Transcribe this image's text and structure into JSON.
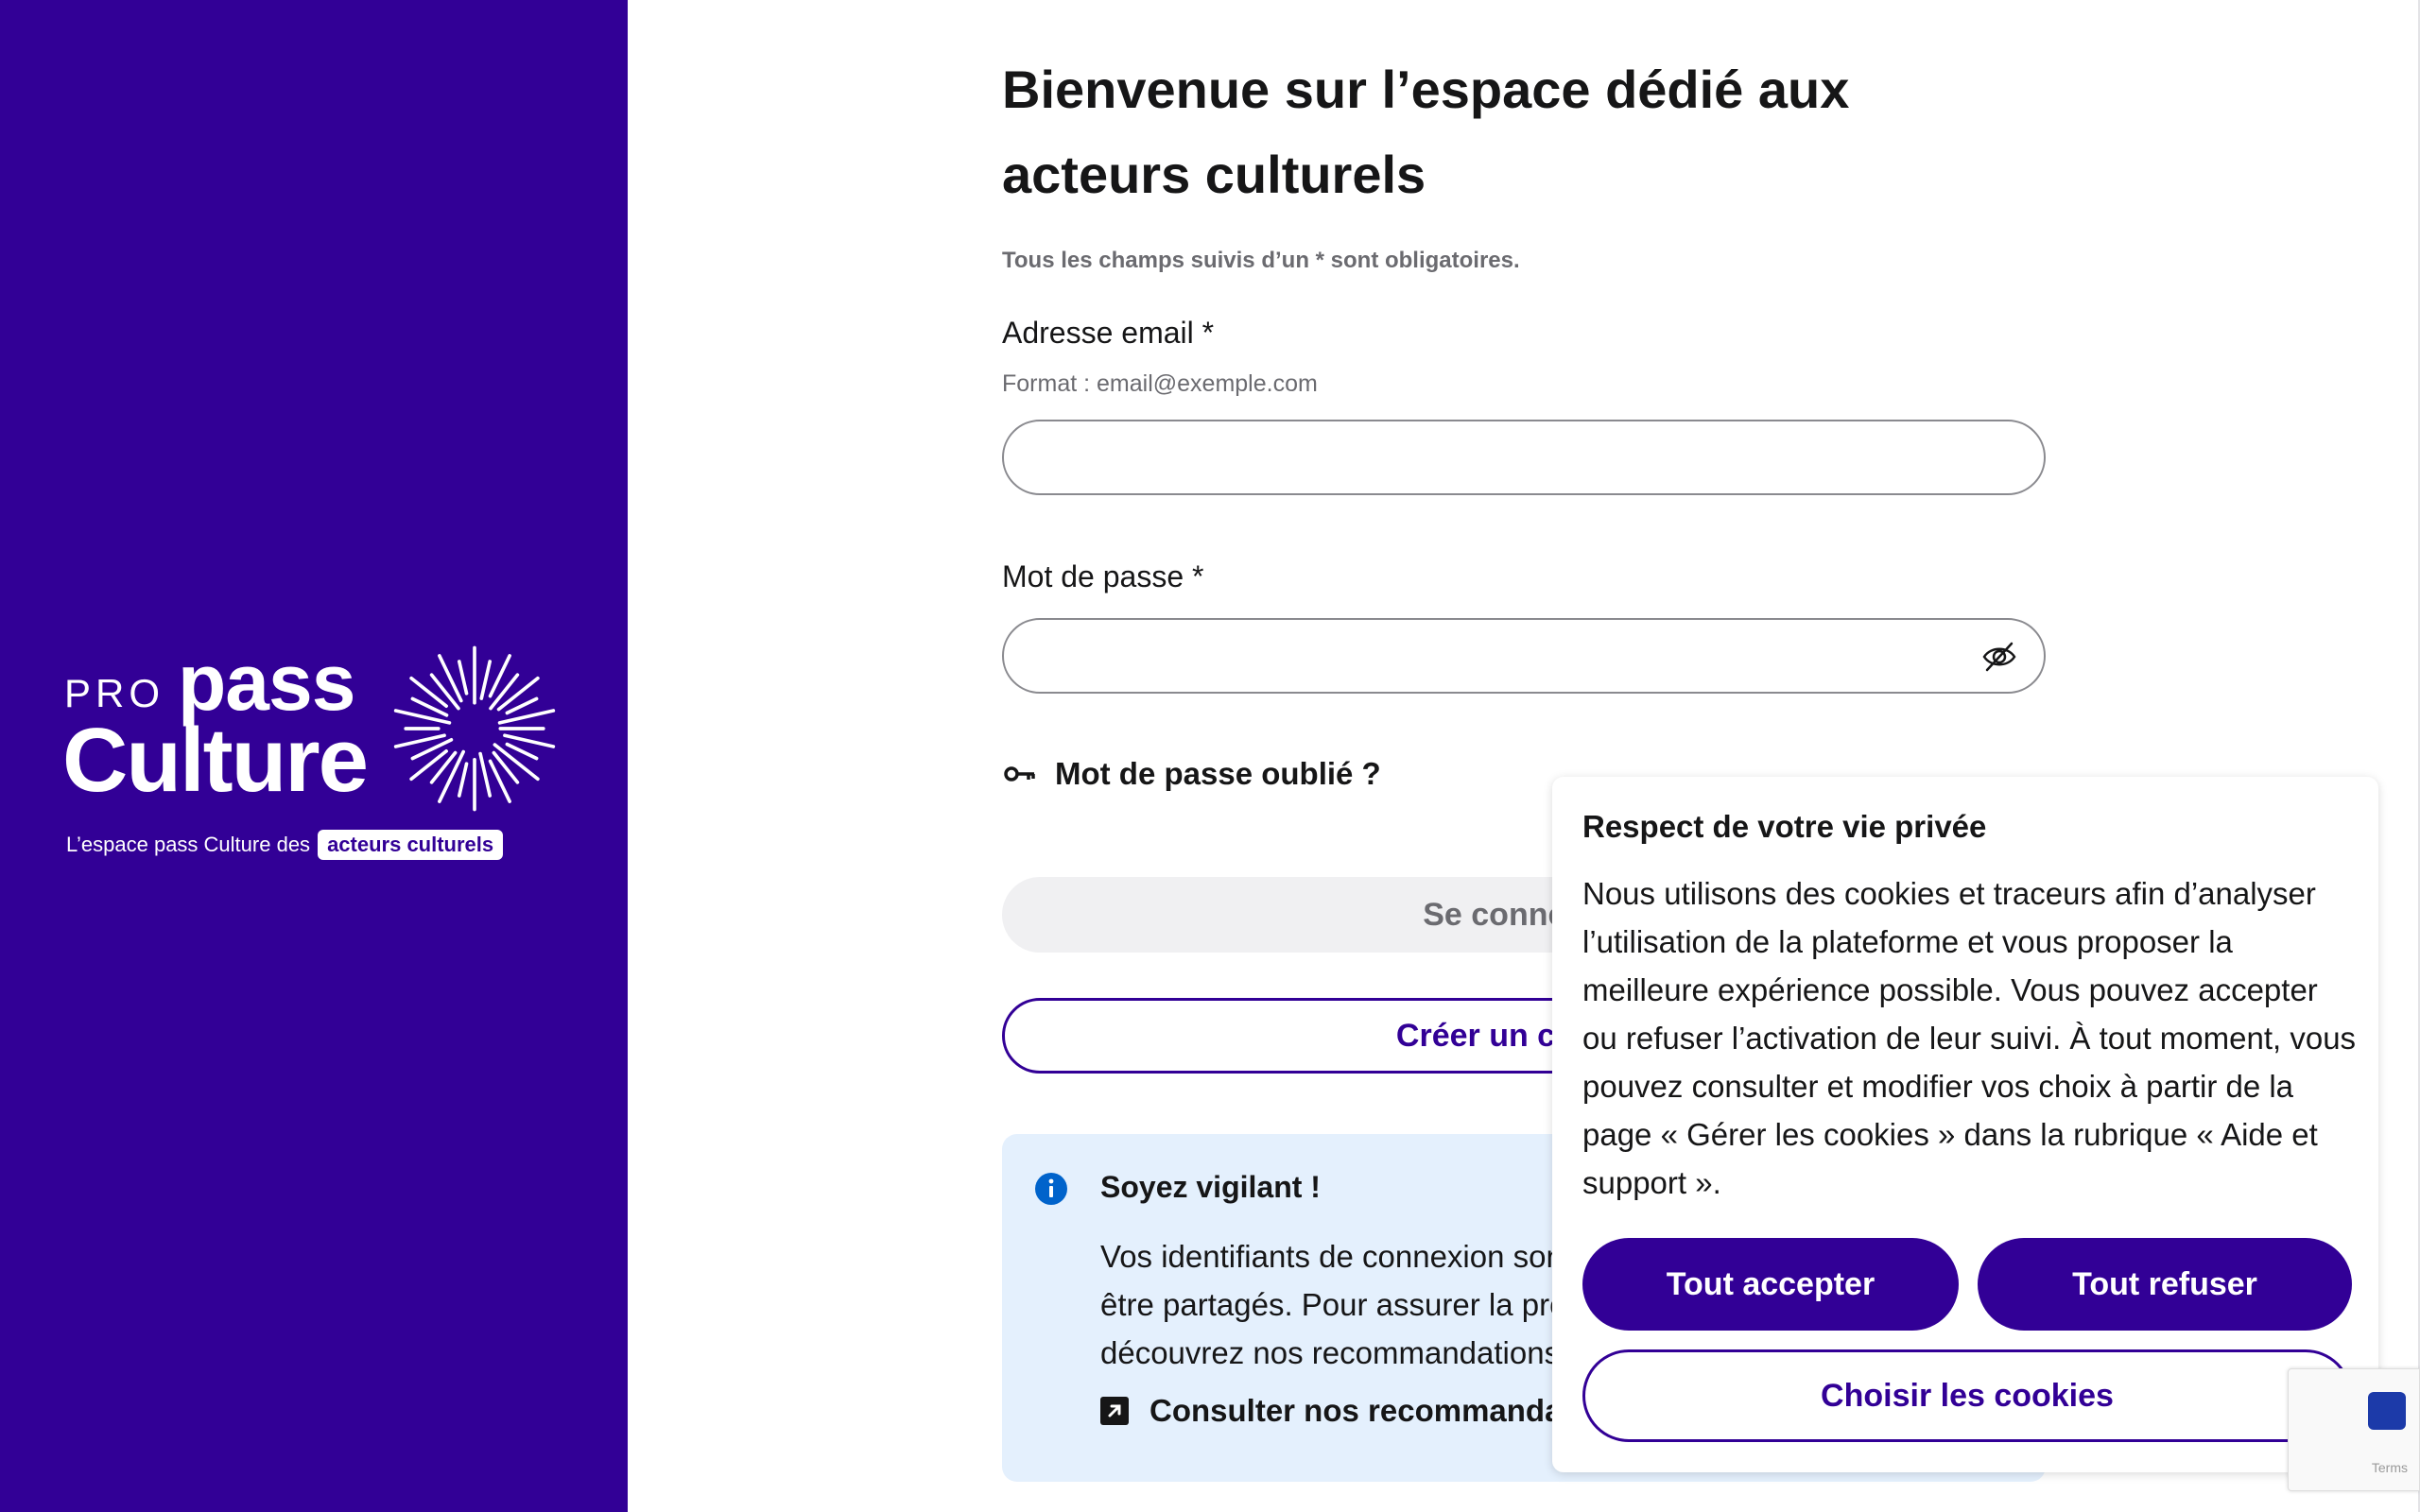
{
  "brand": {
    "pro": "PRO",
    "pass": "pass",
    "culture": "Culture",
    "tagline": "L’espace pass Culture des",
    "tagline_chip": "acteurs culturels",
    "panel_color": "#320096"
  },
  "form": {
    "title": "Bienvenue sur l’espace dédié aux acteurs culturels",
    "required_note": "Tous les champs suivis d’un * sont obligatoires.",
    "email_label": "Adresse email *",
    "email_hint": "Format : email@exemple.com",
    "email_value": "",
    "password_label": "Mot de passe *",
    "password_value": "",
    "password_toggle_icon": "eye-slash-icon",
    "forgot_label": "Mot de passe oublié ?",
    "forgot_icon": "key-icon",
    "connect_label": "Se connecter",
    "create_label": "Créer un compte"
  },
  "alert": {
    "icon": "info-icon",
    "title": "Soyez vigilant !",
    "body": "Vos identifiants de connexion sont personnels et ne doivent pas être partagés. Pour assurer la protection de votre compte, découvrez nos recommandations.",
    "link_icon": "external-link-icon",
    "link_label": "Consulter nos recommandations"
  },
  "cookie": {
    "title": "Respect de votre vie privée",
    "body": "Nous utilisons des cookies et traceurs afin d’analyser l’utilisation de la plateforme et vous proposer la meilleure expérience possible. Vous pouvez accepter ou refuser l’activation de leur suivi. À tout moment, vous pouvez consulter et modifier vos choix à partir de la page « Gérer les cookies » dans la rubrique « Aide et support ».",
    "accept_label": "Tout accepter",
    "refuse_label": "Tout refuser",
    "choose_label": "Choisir les cookies"
  },
  "recaptcha": {
    "text": "Terms"
  },
  "colors": {
    "primary": "#320096",
    "info_bg": "#e4f0fd",
    "info_icon": "#0063cb"
  }
}
